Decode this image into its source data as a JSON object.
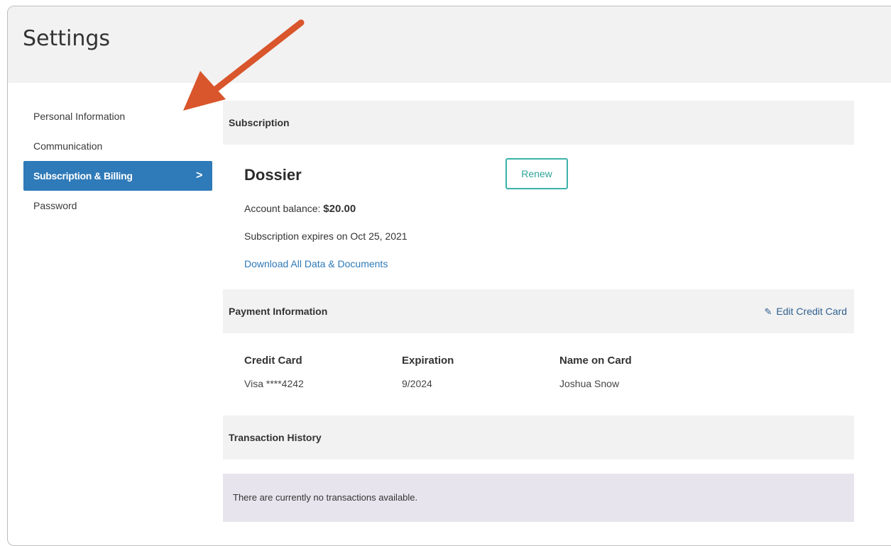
{
  "header": {
    "title": "Settings"
  },
  "sidebar": {
    "items": [
      {
        "label": "Personal Information"
      },
      {
        "label": "Communication"
      },
      {
        "label": "Subscription & Billing",
        "active": true
      },
      {
        "label": "Password"
      }
    ],
    "active_chevron": ">"
  },
  "subscription": {
    "section_title": "Subscription",
    "plan_name": "Dossier",
    "renew_label": "Renew",
    "balance_label": "Account balance: ",
    "balance_value": "$20.00",
    "expires_text": "Subscription expires on Oct 25, 2021",
    "download_link": "Download All Data & Documents"
  },
  "payment": {
    "section_title": "Payment Information",
    "edit_label": "Edit Credit Card",
    "edit_icon": "pencil-icon",
    "columns": [
      {
        "header": "Credit Card",
        "value": "Visa ****4242"
      },
      {
        "header": "Expiration",
        "value": "9/2024"
      },
      {
        "header": "Name on Card",
        "value": "Joshua Snow"
      }
    ]
  },
  "transactions": {
    "section_title": "Transaction History",
    "empty_message": "There are currently no transactions available."
  },
  "colors": {
    "accent": "#2f7ab8",
    "renew": "#3bb3a8",
    "annotation_arrow": "#d9552b",
    "empty_bg": "#e8e4ee"
  }
}
